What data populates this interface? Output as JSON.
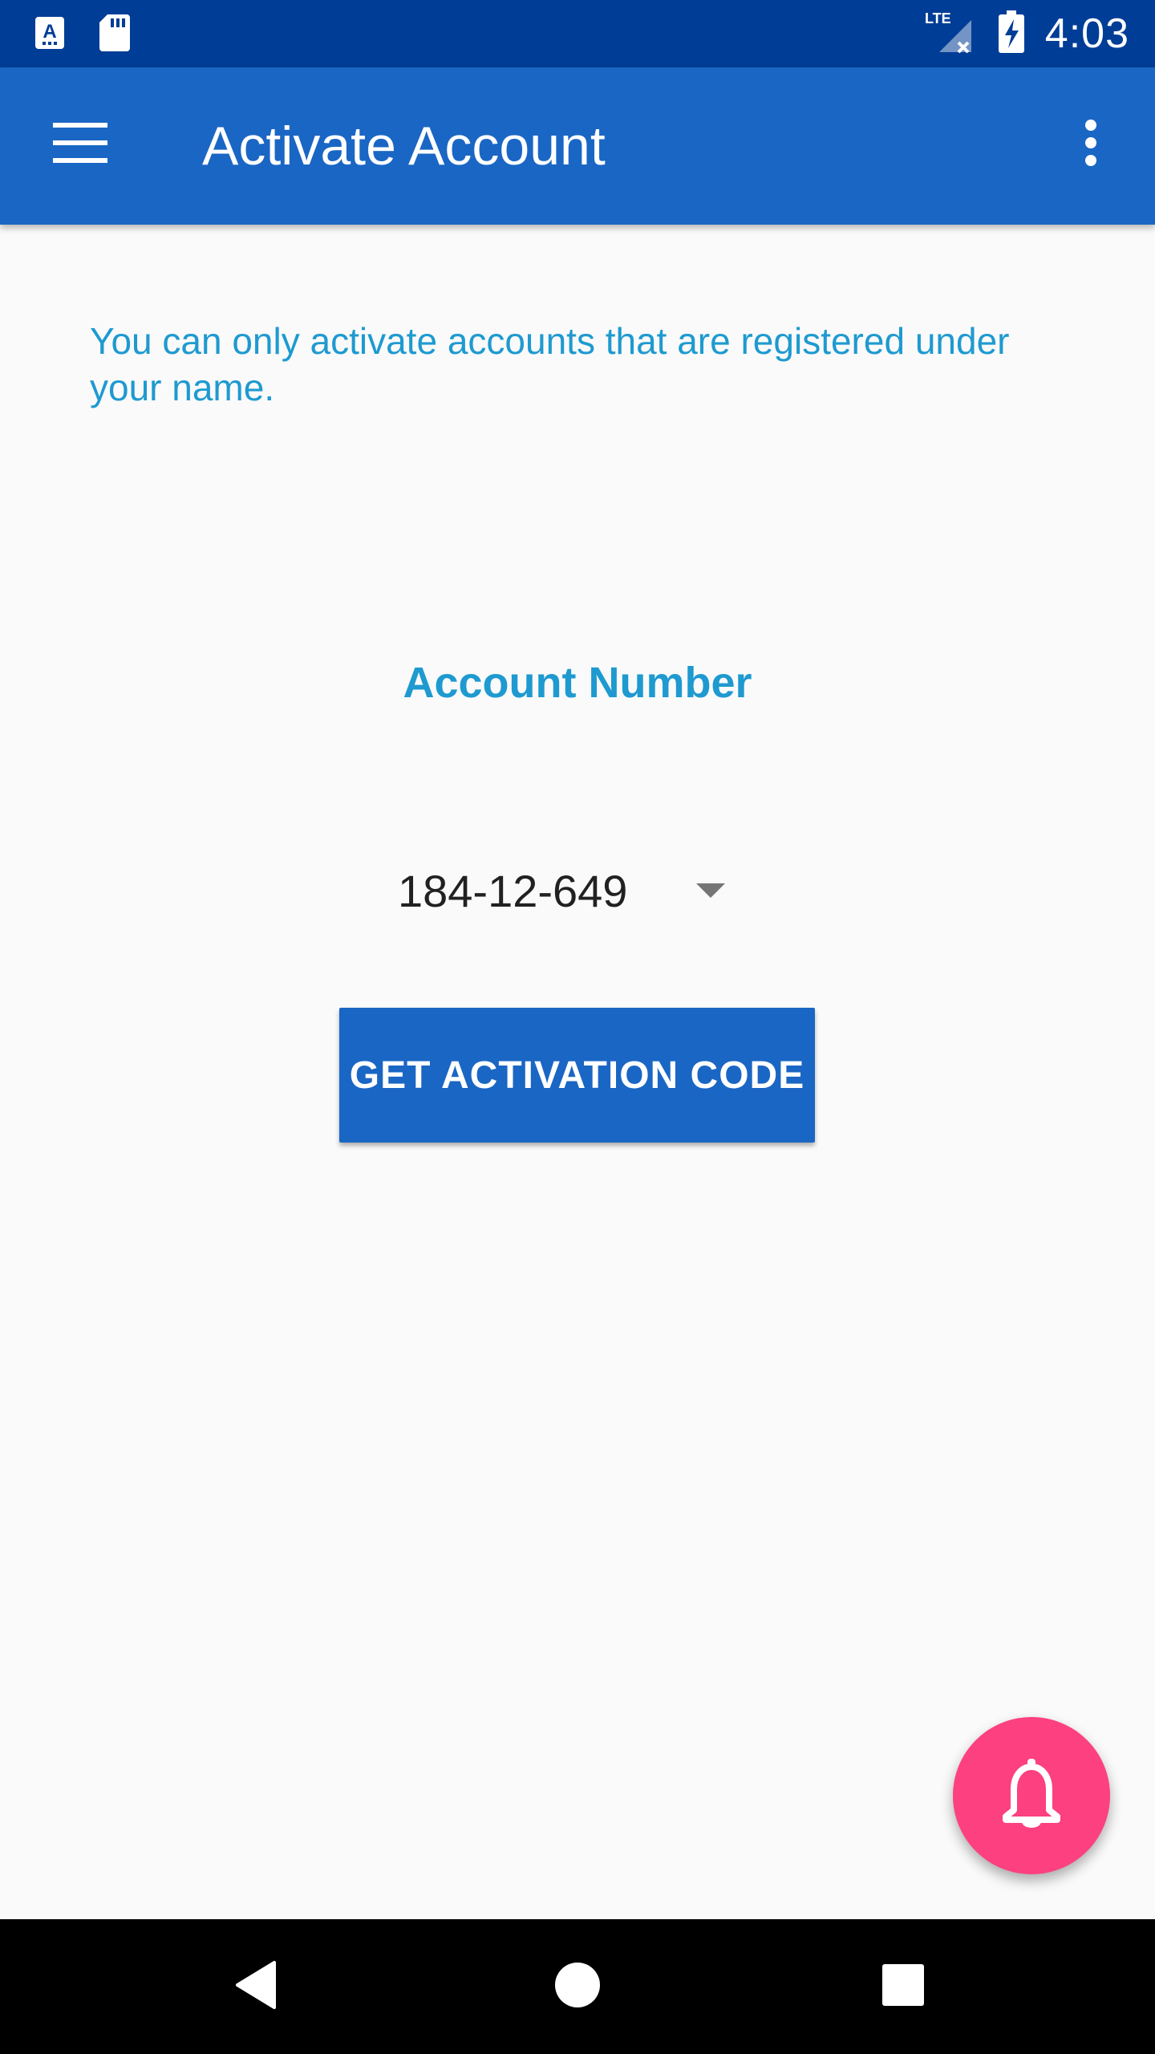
{
  "status_bar": {
    "time": "4:03",
    "network_label": "LTE",
    "icons": [
      "keyboard-a-icon",
      "sd-card-icon",
      "signal-no-data-icon",
      "battery-charging-icon"
    ]
  },
  "app_bar": {
    "title": "Activate Account",
    "icons": [
      "hamburger-menu-icon",
      "more-vert-icon"
    ]
  },
  "content": {
    "info_text": "You can only activate accounts that are registered under your name.",
    "account_label": "Account Number",
    "account_selected": "184-12-649",
    "button_label": "GET ACTIVATION CODE"
  },
  "fab": {
    "icon": "bell-icon"
  },
  "nav_bar": {
    "icons": [
      "back-icon",
      "home-icon",
      "recents-icon"
    ]
  },
  "colors": {
    "status_bar": "#003d96",
    "primary": "#1a66c4",
    "accent_text": "#1e9ad0",
    "fab": "#fc4080",
    "background": "#fafafa"
  }
}
